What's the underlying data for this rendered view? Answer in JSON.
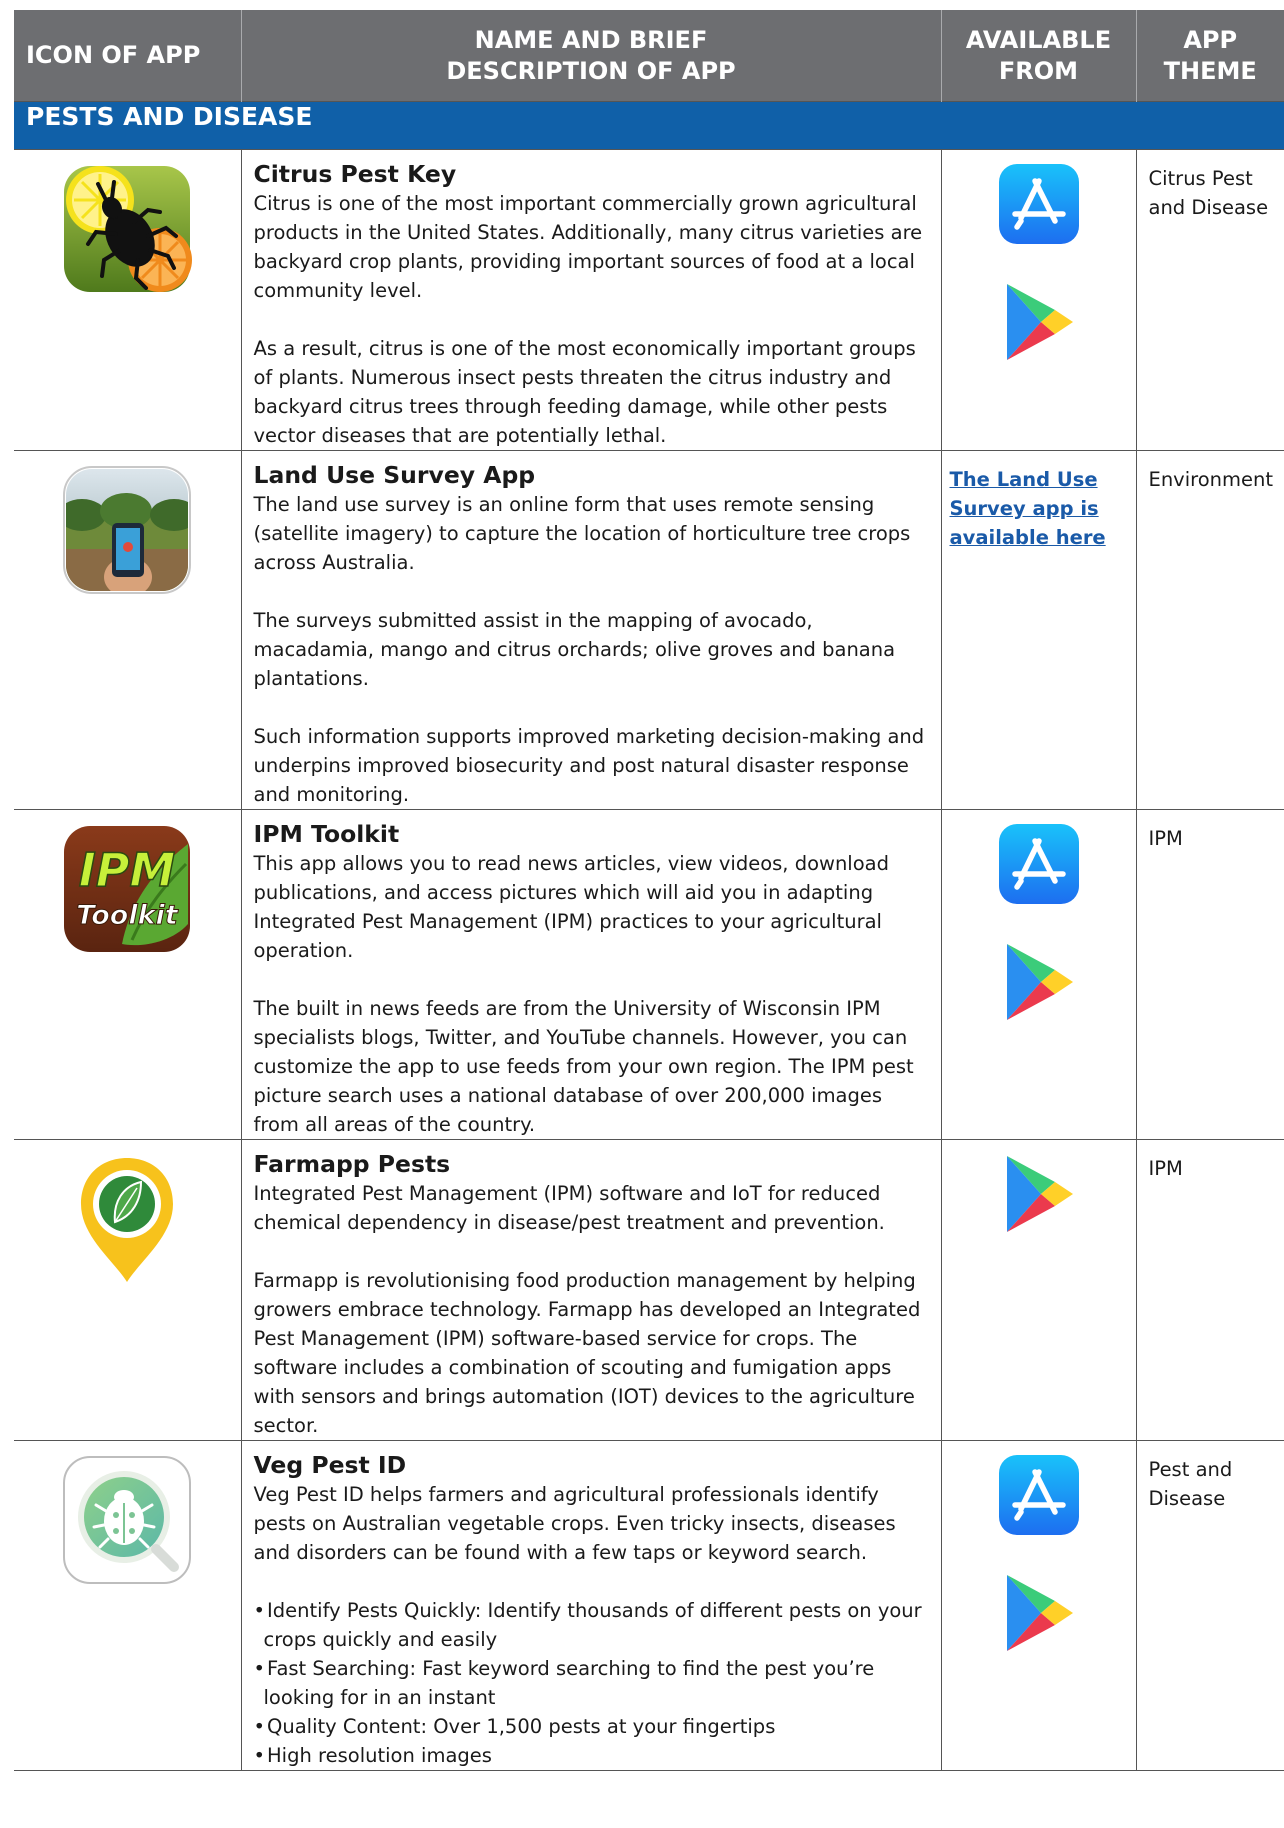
{
  "header": {
    "col1": "ICON OF APP",
    "col2_line1": "NAME AND BRIEF",
    "col2_line2": "DESCRIPTION OF APP",
    "col3_line1": "AVAILABLE",
    "col3_line2": "FROM",
    "col4_line1": "APP",
    "col4_line2": "THEME"
  },
  "section": "PESTS AND DISEASE",
  "apps": [
    {
      "name": "Citrus Pest Key",
      "paragraphs": [
        "Citrus is one of the most important commercially grown agricultural products in the United States. Additionally, many citrus varieties are backyard crop plants, providing important sources of food at a local community level.",
        "As a result, citrus is one of the most economically important groups of plants. Numerous insect pests threaten the citrus industry and backyard citrus trees through feeding damage, while other pests vector diseases that are potentially lethal."
      ],
      "stores": [
        "app-store-icon",
        "google-play-icon"
      ],
      "theme": "Citrus Pest and Disease"
    },
    {
      "name": "Land Use Survey App",
      "paragraphs": [
        "The land use survey is an online form that uses remote sensing (satellite imagery) to capture the location of horticulture tree crops across Australia.",
        "The surveys submitted assist in the mapping of avocado, macadamia, mango and citrus orchards; olive groves and banana plantations.",
        "Such information supports improved marketing decision-making and underpins improved biosecurity and post natural disaster response and monitoring."
      ],
      "link": "The Land Use Survey app is available here",
      "theme": "Environment"
    },
    {
      "name": "IPM Toolkit",
      "icon_text_1": "IPM",
      "icon_text_2": "Toolkit",
      "paragraphs": [
        "This app allows you to read news articles, view videos, download publications, and access pictures which will aid you in adapting Integrated Pest Management (IPM) practices to your agricultural operation.",
        "The built in news feeds are from the University of Wisconsin IPM specialists blogs, Twitter, and YouTube channels. However, you can customize the app to use feeds from your own region. The IPM pest picture search uses a national database of over 200,000 images from all areas of the country."
      ],
      "stores": [
        "app-store-icon",
        "google-play-icon"
      ],
      "theme": "IPM"
    },
    {
      "name": "Farmapp Pests",
      "paragraphs": [
        "Integrated Pest Management (IPM) software and IoT for reduced chemical dependency in disease/pest treatment and prevention.",
        "Farmapp is revolutionising food production management by helping growers embrace technology. Farmapp has developed an Integrated Pest Management (IPM) software-based service for crops. The software includes a combination of scouting and fumigation apps with sensors and brings automation (IOT) devices to the agriculture sector."
      ],
      "stores": [
        "google-play-icon"
      ],
      "theme": "IPM"
    },
    {
      "name": "Veg Pest ID",
      "paragraphs": [
        "Veg Pest ID helps farmers and agricultural professionals identify pests on Australian vegetable crops. Even tricky insects, diseases and disorders can be found with a few taps or keyword search."
      ],
      "bullets": [
        "Identify Pests Quickly: Identify thousands of different pests on your crops quickly and easily",
        "Fast Searching: Fast keyword searching to find the pest you’re looking for in an instant",
        "Quality Content: Over 1,500 pests at your fingertips",
        "High resolution images"
      ],
      "stores": [
        "app-store-icon",
        "google-play-icon"
      ],
      "theme": "Pest and Disease"
    }
  ],
  "colors": {
    "header_bg": "#6d6e71",
    "section_bg": "#1060a8",
    "link": "#1a5aa8",
    "app_store_blue": "#1e8df2",
    "play_green": "#3bcc7a",
    "play_blue": "#2a8ff0",
    "play_yellow": "#ffd028",
    "play_red": "#eb3a4d"
  }
}
